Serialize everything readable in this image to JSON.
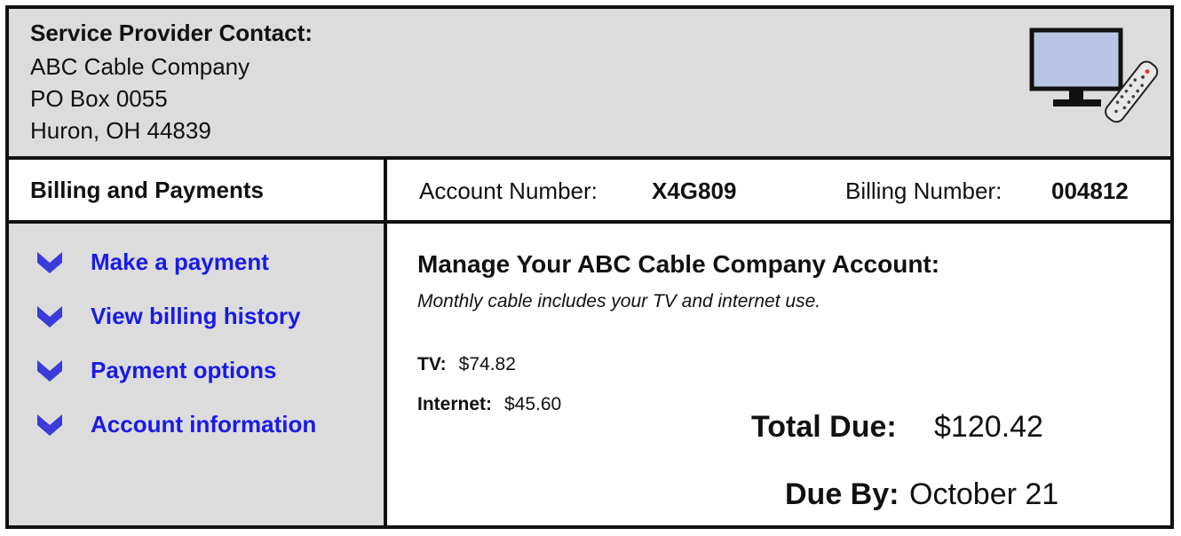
{
  "provider": {
    "heading": "Service Provider Contact:",
    "name": "ABC Cable Company",
    "address_line": "PO Box 0055",
    "city_line": "Huron, OH 44839"
  },
  "illustration": {
    "icon": "tv-with-remote-icon"
  },
  "section_title": "Billing and Payments",
  "account": {
    "account_label": "Account Number:",
    "account_number": "X4G809",
    "billing_label": "Billing Number:",
    "billing_number": "004812"
  },
  "nav": {
    "items": [
      {
        "label": "Make a payment",
        "icon": "chevron-down-icon"
      },
      {
        "label": "View billing history",
        "icon": "chevron-down-icon"
      },
      {
        "label": "Payment options",
        "icon": "chevron-down-icon"
      },
      {
        "label": "Account information",
        "icon": "chevron-down-icon"
      }
    ],
    "link_color": "#1a1ae6",
    "chevron_color": "#3b3bd9"
  },
  "main": {
    "title": "Manage Your ABC Cable Company Account:",
    "subtitle": "Monthly cable includes your TV and internet use.",
    "charges": [
      {
        "label": "TV:",
        "amount": "$74.82"
      },
      {
        "label": "Internet:",
        "amount": "$45.60"
      }
    ],
    "total_label": "Total Due:",
    "total_value": "$120.42",
    "due_label": "Due By:",
    "due_value": "October 21"
  }
}
